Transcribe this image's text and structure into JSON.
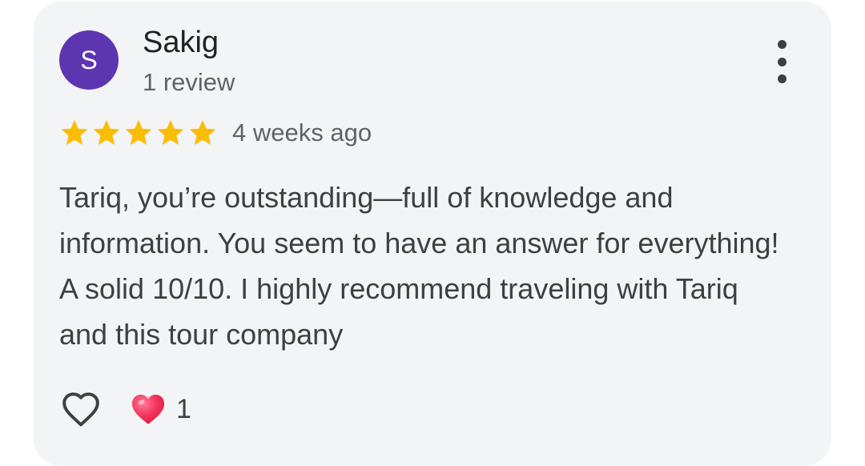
{
  "review": {
    "author": {
      "initial": "S",
      "name": "Sakig",
      "review_count": "1 review",
      "avatar_color": "#5e35b1"
    },
    "rating": {
      "stars": 5,
      "max": 5,
      "star_color": "#fbbc04"
    },
    "time_ago": "4 weeks ago",
    "text": "Tariq, you’re outstanding—full of knowledge and information. You seem to have an answer for everything! A solid 10/10. I highly recommend traveling with Tariq and this tour company",
    "reactions": {
      "like_icon": "heart-outline-icon",
      "heart_emoji_icon": "red-heart-icon",
      "count": "1"
    },
    "menu_icon": "more-vert-icon"
  }
}
